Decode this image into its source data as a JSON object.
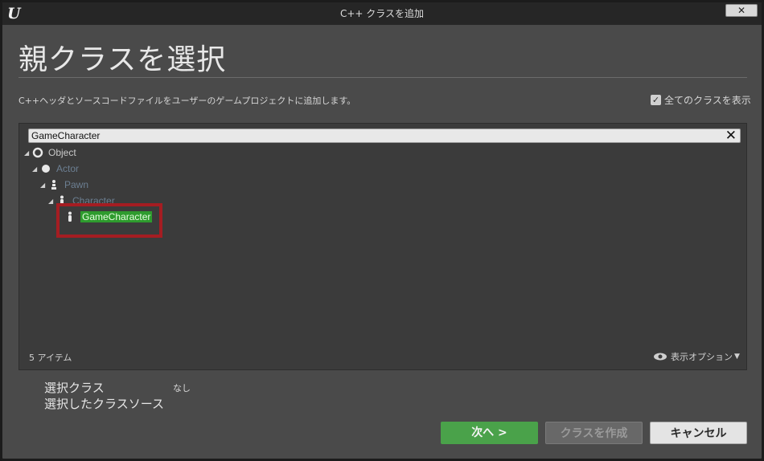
{
  "window": {
    "title": "C++ クラスを追加",
    "logo": "U",
    "close_label": "✕"
  },
  "header": {
    "title": "親クラスを選択",
    "description": "C++ヘッダとソースコードファイルをユーザーのゲームプロジェクトに追加します。",
    "show_all_label": "全てのクラスを表示",
    "show_all_checked": true
  },
  "search": {
    "value": "GameCharacter",
    "clear_icon": "close-icon"
  },
  "tree": {
    "items": [
      {
        "label": "Object",
        "icon": "object-icon",
        "expanded": true
      },
      {
        "label": "Actor",
        "icon": "actor-icon",
        "expanded": true
      },
      {
        "label": "Pawn",
        "icon": "pawn-icon",
        "expanded": true
      },
      {
        "label": "Character",
        "icon": "character-icon",
        "expanded": true
      },
      {
        "label": "GameCharacter",
        "icon": "character-icon",
        "selected": true
      }
    ]
  },
  "footer": {
    "item_count": "5 アイテム",
    "view_options_label": "表示オプション"
  },
  "selection": {
    "class_label": "選択クラス",
    "class_value": "なし",
    "source_label": "選択したクラスソース"
  },
  "buttons": {
    "next_label": "次へ >",
    "create_label": "クラスを作成",
    "cancel_label": "キャンセル"
  },
  "colors": {
    "accent_green": "#4aa24a",
    "selection_green": "#2e9b2e",
    "highlight_red": "#a51d22",
    "panel_bg": "#3b3b3b",
    "window_bg": "#4a4a4a"
  }
}
